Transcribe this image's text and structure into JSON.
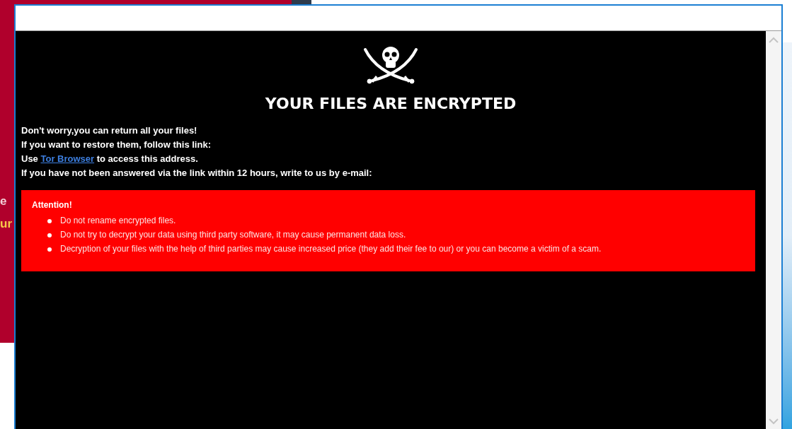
{
  "background_window": {
    "texts": [
      {
        "text": "e",
        "color": "#f2d0d8"
      },
      {
        "text": "ur",
        "color": "#f7c84a"
      }
    ]
  },
  "note_window": {
    "heading": "YOUR FILES ARE ENCRYPTED",
    "lines": [
      {
        "text": "Don't worry,you can return all your files!"
      },
      {
        "text": "If you want to restore them, follow this link:"
      },
      {
        "before": "Use",
        "link": "Tor Browser",
        "after": "to access this address."
      },
      {
        "text": "If you have not been answered via the link within 12 hours, write to us by e-mail:"
      }
    ],
    "notice": {
      "title": "Attention!",
      "items": [
        "Do not rename encrypted files.",
        "Do not try to decrypt your data using third party software, it may cause permanent data loss.",
        "Decryption of your files with the help of third parties may cause increased price (they add their fee to our) or you can become a victim of a scam."
      ]
    }
  }
}
